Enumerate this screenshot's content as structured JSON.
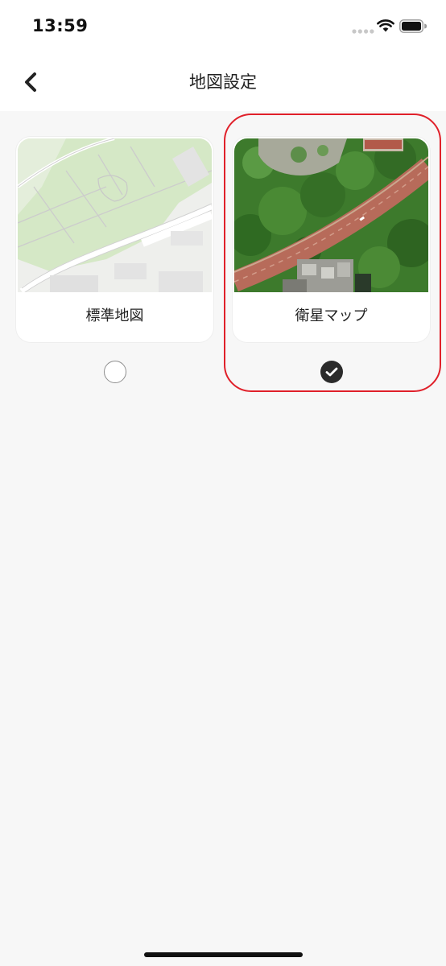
{
  "status_bar": {
    "time": "13:59",
    "icons": [
      "signal-dots-icon",
      "wifi-icon",
      "battery-icon"
    ]
  },
  "header": {
    "title": "地図設定",
    "back_icon": "chevron-left-icon"
  },
  "map_options": [
    {
      "label": "標準地図",
      "selected": false
    },
    {
      "label": "衛星マップ",
      "selected": true
    }
  ],
  "colors": {
    "background": "#f7f7f7",
    "card": "#ffffff",
    "highlight": "#e0202a",
    "check_fill": "#2b2b2b",
    "standard_map_green": "#d6e9c8",
    "road_red": "#b86a58",
    "foliage": "#3f7f2c"
  }
}
